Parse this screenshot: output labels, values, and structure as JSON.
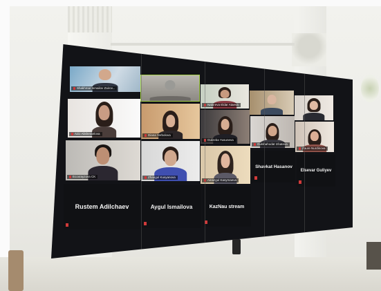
{
  "scene": {
    "wall_color": "#ecece7",
    "screen_color": "#121317"
  },
  "participants": {
    "row1": [
      {
        "label": "Shakhmar Ismailov Zairov..."
      },
      {
        "label": ""
      },
      {
        "label": "Nabireva Eldar Ataeva"
      },
      {
        "label": ""
      },
      {
        "label": ""
      }
    ],
    "row2": [
      {
        "label": "Aziz Alisheranlova"
      },
      {
        "label": "Diana Yerbolova"
      },
      {
        "label": "Gulzeba Yusuneva"
      },
      {
        "label": "Gulshahodat Izbateva"
      },
      {
        "label": "Zaure Nurdinova"
      }
    ],
    "row3": [
      {
        "label": "Ecoxrayzova CK"
      },
      {
        "label": "Zhangul Kusyanova"
      },
      {
        "label": "Ainazgul Kasymaeva"
      }
    ],
    "name_tiles": {
      "shavkat": "Shavkat Hasanov",
      "elsevar": "Elsevar Guliyev",
      "rustem": "Rustem Adilchaev",
      "aygul": "Aygul Ismailova",
      "kaznau": "KazNau stream"
    }
  }
}
